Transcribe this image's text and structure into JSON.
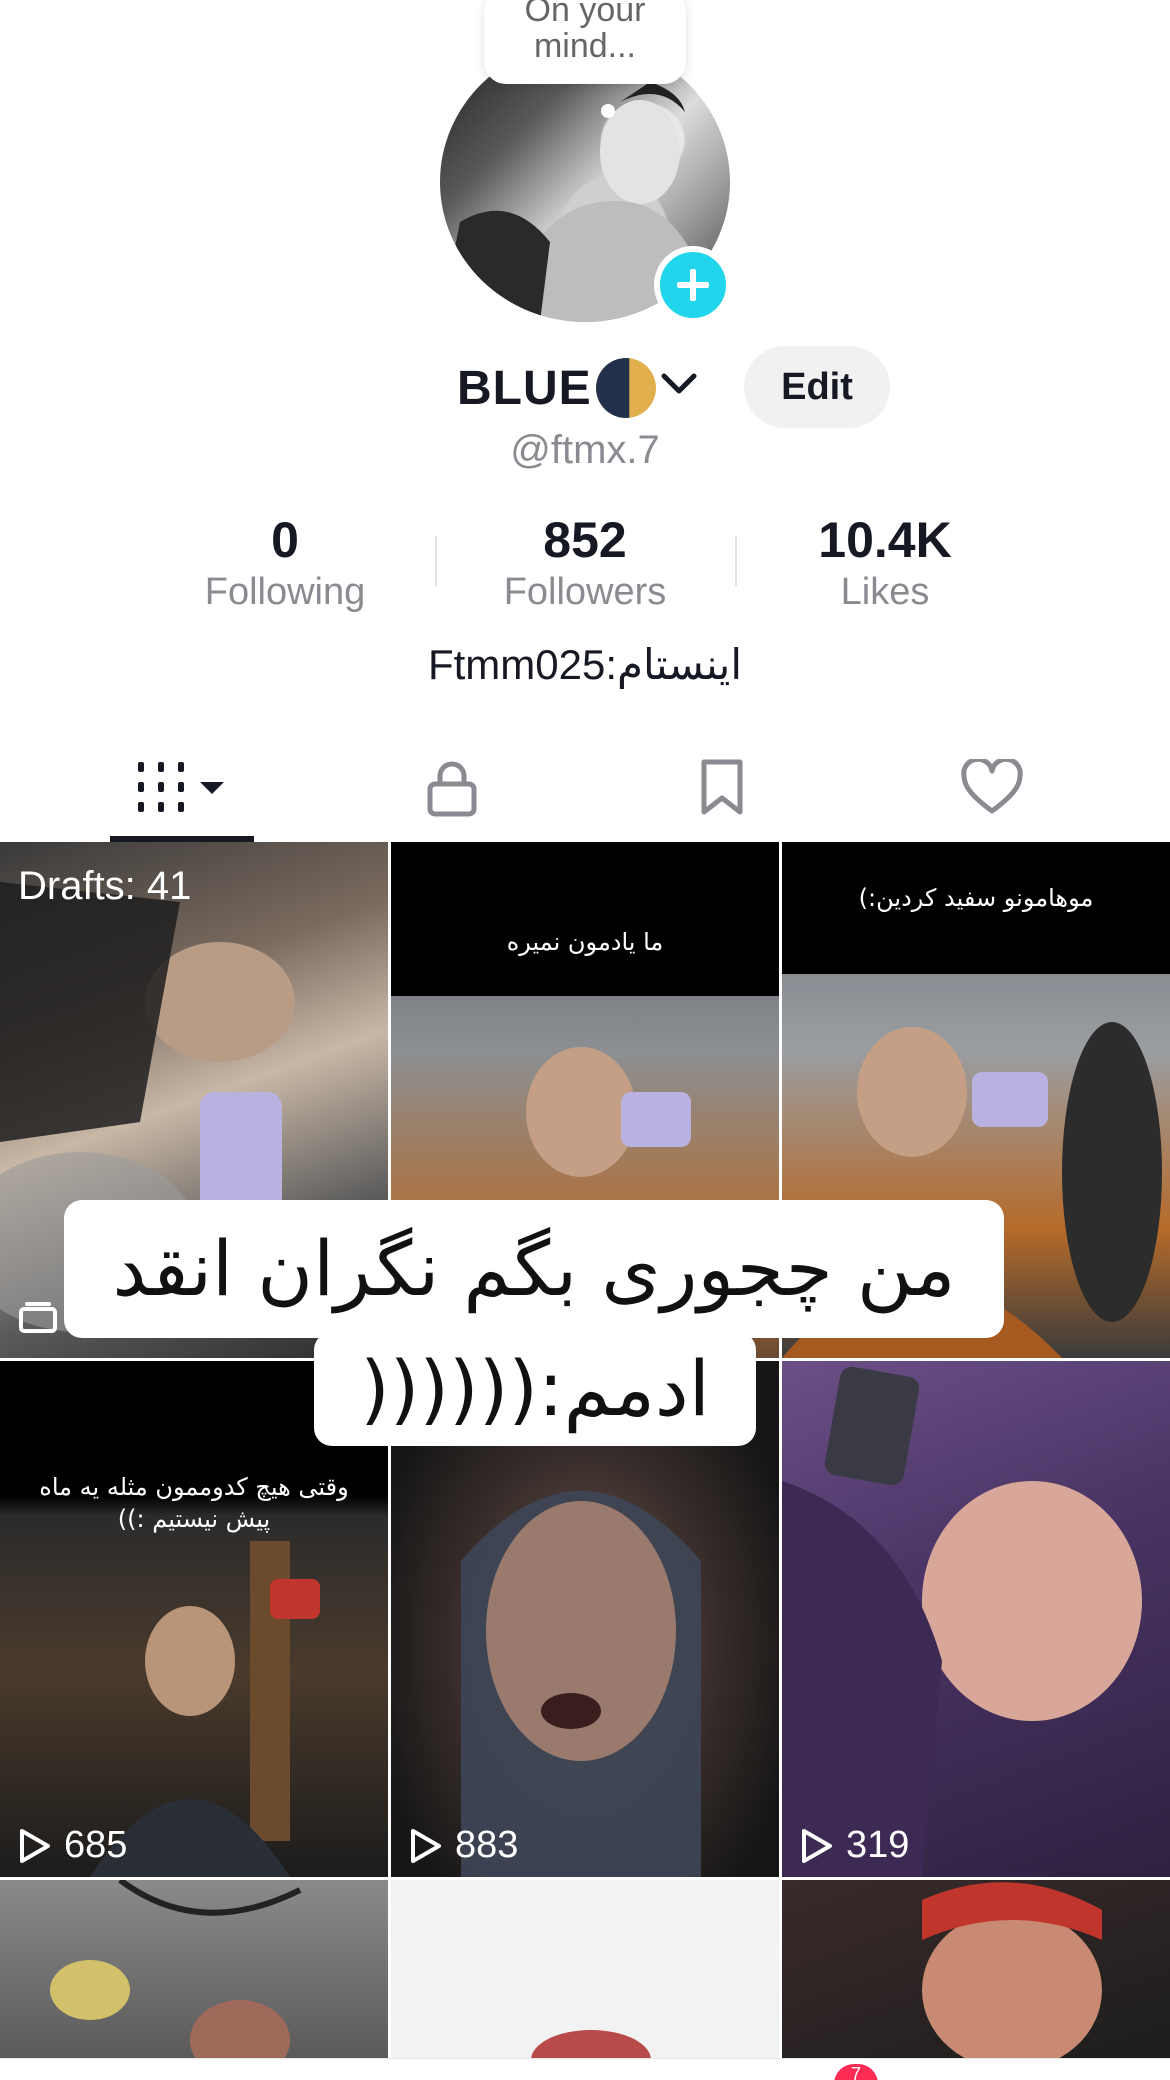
{
  "bubble": {
    "line1": "On your",
    "line2": "mind..."
  },
  "profile": {
    "display_name": "BLUE",
    "handle": "@ftmx.7",
    "edit_label": "Edit",
    "bio": "اینستام:Ftmm025"
  },
  "stats": [
    {
      "value": "0",
      "label": "Following"
    },
    {
      "value": "852",
      "label": "Followers"
    },
    {
      "value": "10.4K",
      "label": "Likes"
    }
  ],
  "tabs": [
    {
      "icon": "grid-icon",
      "active": true
    },
    {
      "icon": "lock-icon",
      "active": false
    },
    {
      "icon": "bookmark-icon",
      "active": false
    },
    {
      "icon": "heart-icon",
      "active": false
    }
  ],
  "grid": {
    "drafts_label": "Drafts: 41",
    "captions": {
      "v2": "ما یادمون نمیره",
      "v3": "موهامونو سفید کردین:)",
      "v4_line1": "وقتی هیچ کدوممون مثله یه ماه",
      "v4_line2": "پیش نیستیم :))"
    },
    "counts": {
      "v4": "685",
      "v5": "883",
      "v6": "319"
    }
  },
  "overlay": {
    "line1": "من چجوری بگم نگران انقد",
    "line2": "ادمم:(((((("
  },
  "nav": {
    "inbox_badge": "7"
  },
  "colors": {
    "accent": "#20d5ec",
    "badge": "#fe2c55",
    "text": "#161823",
    "muted": "#8a8b91"
  }
}
